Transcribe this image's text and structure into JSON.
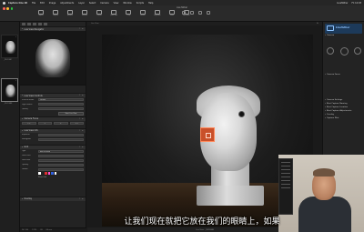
{
  "menubar": {
    "app_name": "Capture One 20",
    "items": [
      "File",
      "Edit",
      "Image",
      "Adjustments",
      "Layer",
      "Select",
      "Camera",
      "View",
      "Window",
      "Scripts",
      "Help"
    ],
    "right": [
      "LiveTether",
      "Fri 12:03"
    ]
  },
  "toolbar": {
    "window_title": "Live Tether",
    "tools": [
      "Import",
      "Capture",
      "Browse",
      "Session",
      "Cursor",
      "Quick Edit",
      "Crop",
      "Rotate",
      "Keystone",
      "Mask",
      "Annotate",
      "Picker",
      "Zoom"
    ]
  },
  "filmstrip": {
    "thumbs": [
      {
        "caption": "_DSC0087",
        "selected": false
      },
      {
        "caption": "_DSC0088",
        "selected": true
      }
    ]
  },
  "left_panel": {
    "navigator_title": "Live View Navigator",
    "live_view_controls_title": "Live View Controls",
    "controls": [
      {
        "label": "Preview mode",
        "value": "Default"
      },
      {
        "label": "Light source",
        "value": ""
      },
      {
        "label": "Quality",
        "value": ""
      }
    ],
    "controls_button": "Start Live View",
    "camera_focus_title": "Camera Focus",
    "focus_values": [
      "< <",
      "<",
      ">",
      "> >"
    ],
    "live_view_info_title": "Live View Info",
    "info_rows": [
      {
        "label": "Exposure",
        "value": ""
      },
      {
        "label": "Histogram",
        "value": ""
      }
    ],
    "grid_title": "Grid",
    "grid_rows": [
      {
        "label": "Type",
        "value": "Rule of thirds"
      },
      {
        "label": "Grid Lines",
        "value": ""
      },
      {
        "label": "Grid color",
        "value": ""
      },
      {
        "label": "Opacity",
        "value": ""
      },
      {
        "label": "Guides",
        "value": ""
      }
    ],
    "grid_checkbox": "Show Grid",
    "swatch_colors": [
      "#ffffff",
      "#222222",
      "#e03030",
      "#ff4fd0",
      "#2f5fe0",
      "#f3f3f3"
    ],
    "overlay_title": "Overlay",
    "status": [
      "ISO 100",
      "1/125",
      "f/8",
      "80 mm"
    ]
  },
  "viewer": {
    "top_left": "Live View",
    "top_right": "Fit",
    "bottom_caption": "Live View · _DSC0088"
  },
  "right_panel": {
    "connection_title": "LiveTether",
    "section_camera": "Camera",
    "camera_focus": "Camera Focus",
    "items": [
      "Camera Settings",
      "Next Capture Naming",
      "Next Capture Location",
      "Next Capture Adjustments",
      "Overlay",
      "Capture Pilot"
    ]
  },
  "subtitle": "让我们现在就把它放在我们的眼睛上，如果"
}
